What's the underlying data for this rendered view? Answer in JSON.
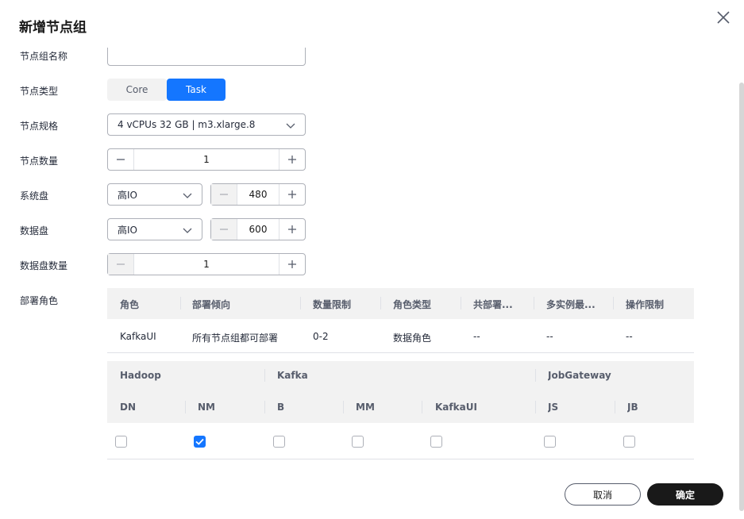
{
  "dialog": {
    "title": "新增节点组",
    "close_icon": "close-icon"
  },
  "form": {
    "group_name_label": "节点组名称",
    "group_name_value": "",
    "node_type_label": "节点类型",
    "node_type_options": [
      "Core",
      "Task"
    ],
    "node_type_selected": "Task",
    "spec_label": "节点规格",
    "spec_value": "4 vCPUs 32 GB | m3.xlarge.8",
    "count_label": "节点数量",
    "count_value": "1",
    "sys_disk_label": "系统盘",
    "sys_disk_type": "高IO",
    "sys_disk_size": "480",
    "data_disk_label": "数据盘",
    "data_disk_type": "高IO",
    "data_disk_size": "600",
    "data_disk_count_label": "数据盘数量",
    "data_disk_count_value": "1",
    "deploy_roles_label": "部署角色"
  },
  "roles_table": {
    "headers": [
      "角色",
      "部署倾向",
      "数量限制",
      "角色类型",
      "共部署...",
      "多实例最...",
      "操作限制"
    ],
    "rows": [
      [
        "KafkaUI",
        "所有节点组都可部署",
        "0-2",
        "数据角色",
        "--",
        "--",
        "--"
      ]
    ]
  },
  "components_table": {
    "groups": [
      "Hadoop",
      "Kafka",
      "JobGateway"
    ],
    "roles": [
      "DN",
      "NM",
      "B",
      "MM",
      "KafkaUI",
      "JS",
      "JB"
    ],
    "checked": [
      false,
      true,
      false,
      false,
      false,
      false,
      false
    ]
  },
  "footer": {
    "cancel_label": "取消",
    "ok_label": "确定"
  },
  "colors": {
    "accent": "#1476ff",
    "primary_button": "#191919",
    "header_bg": "#f2f2f2"
  }
}
